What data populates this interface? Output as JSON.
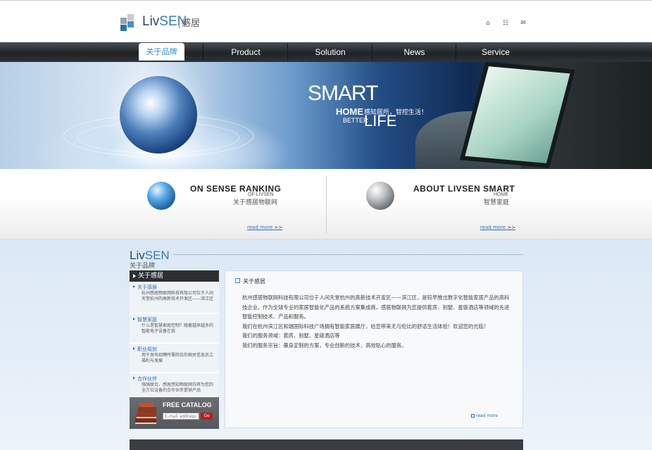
{
  "header": {
    "logo": {
      "brand_liv": "Liv",
      "brand_sen": "SEN",
      "cn": "感居"
    },
    "icons": [
      "home-icon",
      "sitemap-icon",
      "contact-icon"
    ]
  },
  "nav": {
    "items": [
      {
        "label": "关于品牌",
        "active": true
      },
      {
        "label": "Product"
      },
      {
        "label": "Solution"
      },
      {
        "label": "News"
      },
      {
        "label": "Service"
      }
    ]
  },
  "banner": {
    "smart": "SMART",
    "home": "HOME",
    "tagline": "感知居所，智控生活！",
    "better": "BETTER",
    "life": "LIFE"
  },
  "features": [
    {
      "title": "ON SENSE RANKING",
      "sub": "OF LIVSEN",
      "cn": "关于感居物联网",
      "readmore": "read more",
      "arrows": ">>"
    },
    {
      "title": "ABOUT LIVSEN SMART",
      "sub": "HOME",
      "cn": "智慧家庭",
      "readmore": "read more",
      "arrows": ">>"
    }
  ],
  "section": {
    "logo_liv": "Liv",
    "logo_sen": "SEN",
    "cn": "关于品牌"
  },
  "sidebar": {
    "header": "关于感居",
    "items": [
      {
        "title": "关于感居",
        "desc": "杭州感居物联网科技有限公司位于人间天堂杭州的高新技术开发区——滨江区"
      },
      {
        "title": "智慧家庭",
        "desc": "什么是智慧家庭控制？随着越来越多的智能电子设备在我"
      },
      {
        "title": "职业规划",
        "desc": "用于发布招聘所需岗位的相关信息员工福利与发展"
      },
      {
        "title": "合作伙伴",
        "desc": "强强联合，感居感知物联网均将为您的全方位设备的合作伙伴提供产品"
      }
    ],
    "catalog": {
      "title": "FREE CATALOG",
      "placeholder": "E-mail address",
      "go": "Go"
    }
  },
  "content": {
    "title": "关于感居",
    "paragraphs": [
      "杭州感居物联网科技有限公司位于人间天堂杭州的高新技术开发区——滨江区，是较早推出数字化智能家居产品的高科技企业，作为全球专业的家居智能化产品的系统方案集成商，感居物联网为您提供套房、别墅、星级酒店等领域的先进智能控制技术、产品和服务。",
      "我们在杭州滨江区和瑞国际科技广场拥有智能家居展厅，给您带来无与伦比的舒适生活体验！欢迎您的光临！",
      "我们的服务领域：套房、别墅、星级酒店等",
      "我们的服务宗旨：量身定制的方案，专业创新的技术，高效贴心的服务。"
    ],
    "more": "read more"
  }
}
